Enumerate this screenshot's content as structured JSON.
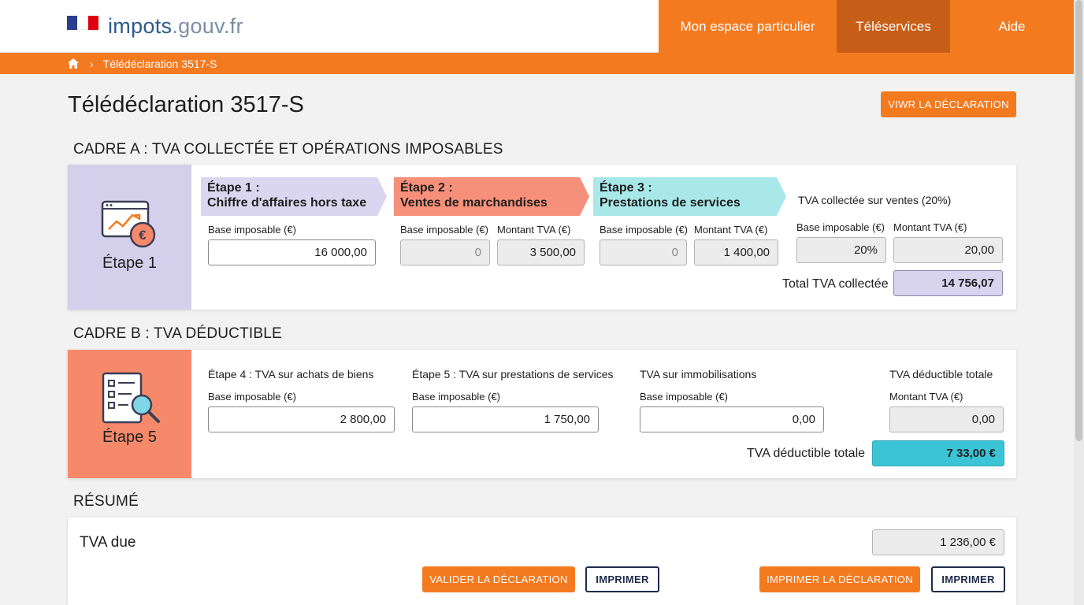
{
  "header": {
    "logo_name": "impots",
    "logo_ext": ".gouv.fr",
    "flag_colors": [
      "#2a3d8f",
      "#ffffff",
      "#e1000f"
    ],
    "nav": [
      {
        "label": "Mon espace particulier",
        "active": false
      },
      {
        "label": "Téléservices",
        "active": true
      },
      {
        "label": "Aide",
        "active": false
      }
    ]
  },
  "breadcrumb": {
    "icon": "home-icon",
    "separator": "›",
    "current": "Télédéclaration 3517-S"
  },
  "page": {
    "title": "Télédéclaration 3517-S",
    "view_button": "VIWR LA DÉCLARATION"
  },
  "cadre_a": {
    "title": "CADRE A : TVA COLLECTÉE ET OPÉRATIONS IMPOSABLES",
    "side_label": "Étape 1",
    "side_icon": "revenue-chart-euro-icon",
    "step1": {
      "title_line1": "Étape 1 :",
      "title_line2": "Chiffre d'affaires hors taxe",
      "base_label": "Base imposable (€)",
      "base_value": "16 000,00"
    },
    "step2": {
      "title_line1": "Étape 2 :",
      "title_line2": "Ventes de marchandises",
      "base_label": "Base imposable (€)",
      "base_value": "0",
      "tva_label": "Montant TVA (€)",
      "tva_value": "3 500,00"
    },
    "step3": {
      "title_line1": "Étape 3 :",
      "title_line2": "Prestations de services",
      "base_label": "Base imposable (€)",
      "base_value": "0",
      "tva_label": "Montant TVA (€)",
      "tva_value": "1 400,00"
    },
    "sales": {
      "title": "TVA collectée sur ventes (20%)",
      "base_label": "Base imposable (€)",
      "base_value": "20%",
      "tva_label": "Montant TVA (€)",
      "tva_value": "20,00"
    },
    "total_label": "Total TVA collectée",
    "total_value": "14 756,07"
  },
  "cadre_b": {
    "title": "CADRE B : TVA DÉDUCTIBLE",
    "side_label": "Étape 5",
    "side_icon": "checklist-magnifier-icon",
    "step4": {
      "title": "Étape 4 : TVA sur achats de biens",
      "base_label": "Base imposable (€)",
      "base_value": "2 800,00"
    },
    "step5": {
      "title": "Étape 5 : TVA sur prestations de services",
      "base_label": "Base imposable (€)",
      "base_value": "1 750,00"
    },
    "immo": {
      "title": "TVA sur immobilisations",
      "base_label": "Base imposable (€)",
      "base_value": "0,00"
    },
    "deductible": {
      "title": "TVA déductible totale",
      "tva_label": "Montant TVA (€)",
      "tva_value": "0,00"
    },
    "total_label": "TVA déductible totale",
    "total_value": "7 33,00 €"
  },
  "resume": {
    "title": "RÉSUMÉ",
    "tva_due_label": "TVA due",
    "tva_due_value": "1 236,00 €",
    "validate_button": "VALIDER LA DÉCLARATION",
    "print_button": "IMPRIMER",
    "print_declaration_button": "IMPRIMER LA DÉCLARATION",
    "print_button_2": "IMPRIMER"
  },
  "colors": {
    "brand_orange": "#f47a20",
    "nav_active": "#c75e18",
    "cadre_a_side": "#d4cfea",
    "cadre_b_side": "#f7896b",
    "step1_banner": "#dad6ef",
    "step2_banner": "#f7907a",
    "step3_banner": "#a8e8e8",
    "total_collectee": "#d8d4ee",
    "total_deductible": "#3bc4d6"
  }
}
